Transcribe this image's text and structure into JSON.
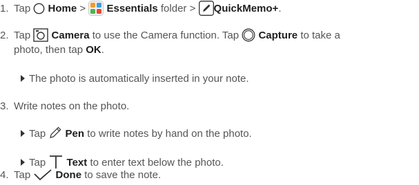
{
  "steps": [
    {
      "number": "1.",
      "tap": "Tap",
      "home_label": "Home",
      "sep1": ">",
      "essentials_label": "Essentials",
      "folder_text": "folder",
      "sep2": ">",
      "quickmemo_label": "QuickMemo+",
      "end": "."
    },
    {
      "number": "2.",
      "tap": "Tap",
      "camera_label": "Camera",
      "mid1": "to use the Camera function. Tap",
      "capture_label": "Capture",
      "mid2": "to take a",
      "line2_pre": "photo, then tap",
      "ok_label": "OK",
      "end": ".",
      "bullet": "The photo is automatically inserted in your note."
    },
    {
      "number": "3.",
      "text": "Write notes on the photo.",
      "bullet1_tap": "Tap",
      "pen_label": "Pen",
      "bullet1_rest": "to write notes by hand on the photo.",
      "bullet2_tap": "Tap",
      "text_label": "Text",
      "bullet2_rest": "to enter text below the photo."
    },
    {
      "number": "4.",
      "tap": "Tap",
      "done_label": "Done",
      "rest": "to save the note."
    }
  ]
}
